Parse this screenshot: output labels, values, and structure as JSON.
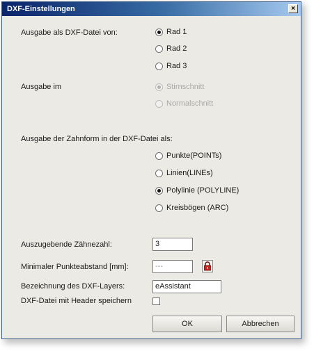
{
  "window": {
    "title": "DXF-Einstellungen",
    "close_glyph": "×"
  },
  "section_output_file": {
    "label": "Ausgabe als DXF-Datei von:",
    "options": [
      {
        "label": "Rad 1",
        "checked": true
      },
      {
        "label": "Rad 2",
        "checked": false
      },
      {
        "label": "Rad 3",
        "checked": false
      }
    ]
  },
  "section_output_in": {
    "label": "Ausgabe im",
    "options": [
      {
        "label": "Stirnschnitt",
        "checked": true,
        "disabled": true
      },
      {
        "label": "Normalschnitt",
        "checked": false,
        "disabled": true
      }
    ]
  },
  "section_shape": {
    "label": "Ausgabe der Zahnform in der DXF-Datei als:",
    "options": [
      {
        "label": "Punkte(POINTs)",
        "checked": false
      },
      {
        "label": "Linien(LINEs)",
        "checked": false
      },
      {
        "label": "Polylinie (POLYLINE)",
        "checked": true
      },
      {
        "label": "Kreisbögen (ARC)",
        "checked": false
      }
    ]
  },
  "fields": {
    "teeth_label": "Auszugebende Zähnezahl:",
    "teeth_value": "3",
    "min_distance_label": "Minimaler Punkteabstand [mm]:",
    "min_distance_value": "---",
    "layer_label": "Bezeichnung des DXF-Layers:",
    "layer_value": "eAssistant",
    "header_label": "DXF-Datei mit Header speichern",
    "header_checked": false
  },
  "buttons": {
    "ok": "OK",
    "cancel": "Abbrechen"
  },
  "colors": {
    "title_start": "#0a246a",
    "title_end": "#a6caf0",
    "dialog_bg": "#eceae4",
    "lock_red": "#cc1f1f"
  }
}
